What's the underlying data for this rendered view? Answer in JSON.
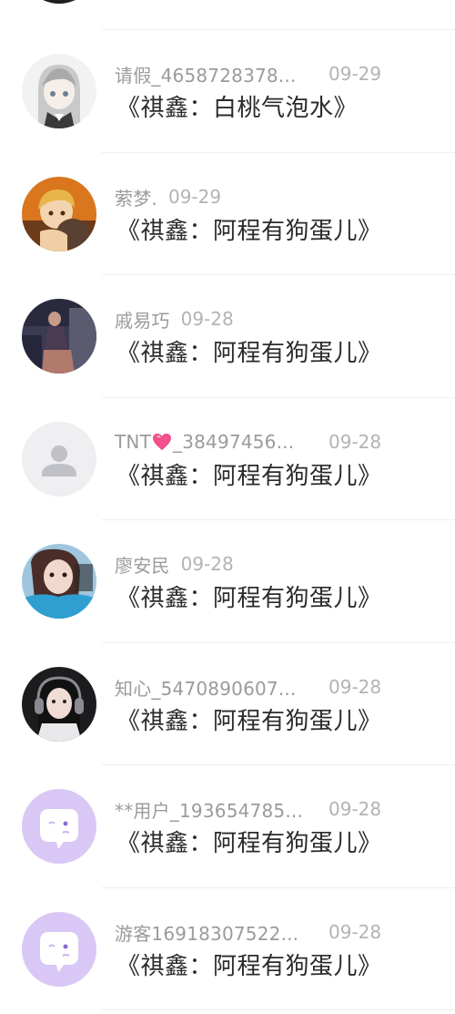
{
  "items": [
    {
      "name": "请假_4658728378...",
      "date": "09-29",
      "title": "《祺鑫：白桃气泡水》",
      "avatar": "anime-girl-avatar"
    },
    {
      "name": "萦梦.",
      "date": "09-29",
      "title": "《祺鑫：阿程有狗蛋儿》",
      "avatar": "anime-boy-avatar"
    },
    {
      "name": "戚易巧",
      "date": "09-28",
      "title": "《祺鑫：阿程有狗蛋儿》",
      "avatar": "photo-avatar"
    },
    {
      "name_prefix": "TNT",
      "name_suffix": "_38497456...",
      "date": "09-28",
      "title": "《祺鑫：阿程有狗蛋儿》",
      "avatar": "default-person-avatar",
      "name_icon": "pink-heart-icon"
    },
    {
      "name": "廖安民",
      "date": "09-28",
      "title": "《祺鑫：阿程有狗蛋儿》",
      "avatar": "selfie-avatar"
    },
    {
      "name": "知心_5470890607...",
      "date": "09-28",
      "title": "《祺鑫：阿程有狗蛋儿》",
      "avatar": "headphones-avatar"
    },
    {
      "name": "**用户_193654785...",
      "date": "09-28",
      "title": "《祺鑫：阿程有狗蛋儿》",
      "avatar": "purple-chat-bubble-avatar"
    },
    {
      "name": "游客16918307522...",
      "date": "09-28",
      "title": "《祺鑫：阿程有狗蛋儿》",
      "avatar": "purple-chat-bubble-avatar"
    }
  ],
  "colors": {
    "name": "#9b9b9b",
    "date": "#b3b3b3",
    "title": "#2b2b2b",
    "divider": "#eeeeee",
    "bubble_bg": "#d9c8f5",
    "heart": "#f0508c"
  }
}
